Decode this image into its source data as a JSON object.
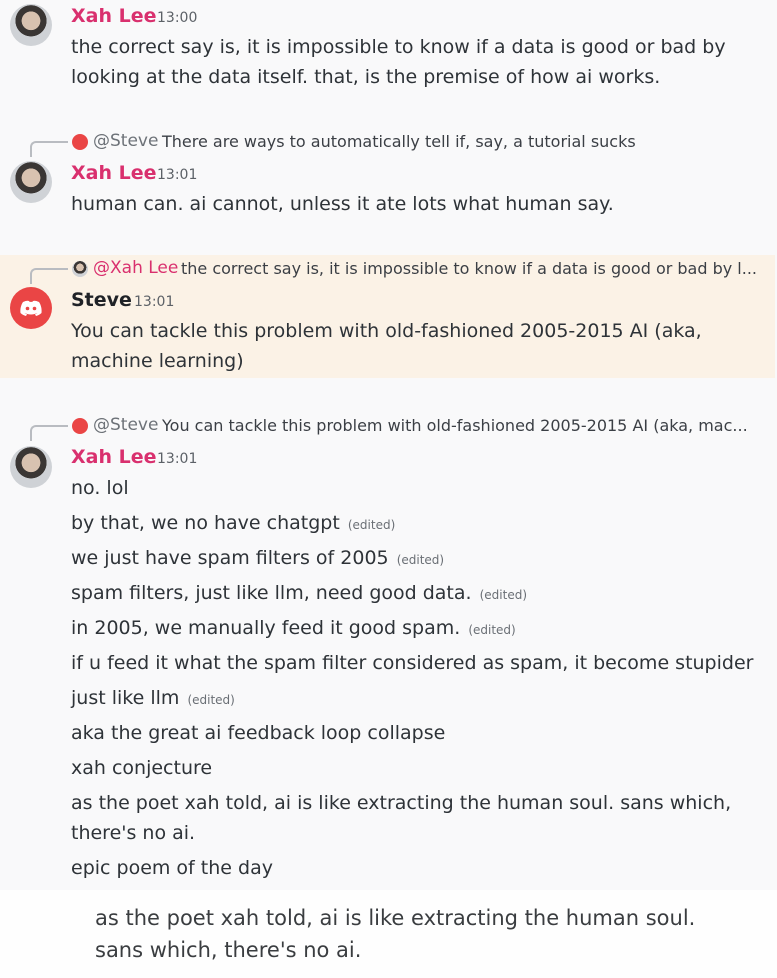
{
  "messages": [
    {
      "author": "Xah Lee",
      "time": "13:00",
      "lines": [
        "the correct say is, it is impossible to know if a data is good or bad by",
        "looking at the data itself. that, is the premise of how ai works."
      ]
    },
    {
      "reply": {
        "mention": "@Steve",
        "text": "There are ways to automatically tell if, say, a tutorial sucks"
      },
      "author": "Xah Lee",
      "time": "13:01",
      "lines": [
        "human can. ai cannot, unless it ate lots what human say."
      ]
    },
    {
      "reply": {
        "mention": "@Xah Lee",
        "text": "the correct say is, it is impossible to know if a data is good or bad by l..."
      },
      "author": "Steve",
      "time": "13:01",
      "lines": [
        "You can tackle this problem with old-fashioned 2005-2015 AI (aka,",
        "machine learning)"
      ]
    },
    {
      "reply": {
        "mention": "@Steve",
        "text": "You can tackle this problem with old-fashioned 2005-2015 AI (aka, mac..."
      },
      "author": "Xah Lee",
      "time": "13:01",
      "lines": [
        {
          "text": "no. lol",
          "edited": ""
        },
        {
          "text": "by that, we no have chatgpt",
          "edited": "(edited)"
        },
        {
          "text": "we just have spam filters of 2005",
          "edited": "(edited)"
        },
        {
          "text": "spam filters, just like llm, need good data.",
          "edited": "(edited)"
        },
        {
          "text": "in 2005, we manually feed it good spam.",
          "edited": "(edited)"
        },
        {
          "text": "if u feed it what the spam filter considered as spam, it become stupider",
          "edited": ""
        },
        {
          "text": "just like llm",
          "edited": "(edited)"
        },
        {
          "text": "aka the great ai feedback loop collapse",
          "edited": ""
        },
        {
          "text": "xah conjecture",
          "edited": ""
        },
        {
          "text": "as the poet xah told, ai is like extracting the human soul. sans which,",
          "edited": ""
        },
        {
          "text": "there's no ai.",
          "edited": ""
        },
        {
          "text": "epic poem of the day",
          "edited": ""
        }
      ]
    }
  ],
  "quote": {
    "lines": [
      "as the poet xah told, ai is like extracting the human soul.",
      "sans which, there's no ai."
    ]
  },
  "colors": {
    "xah_name": "#d9306e",
    "discord_red": "#ea4545",
    "highlight_bg": "#fbf2e6"
  }
}
